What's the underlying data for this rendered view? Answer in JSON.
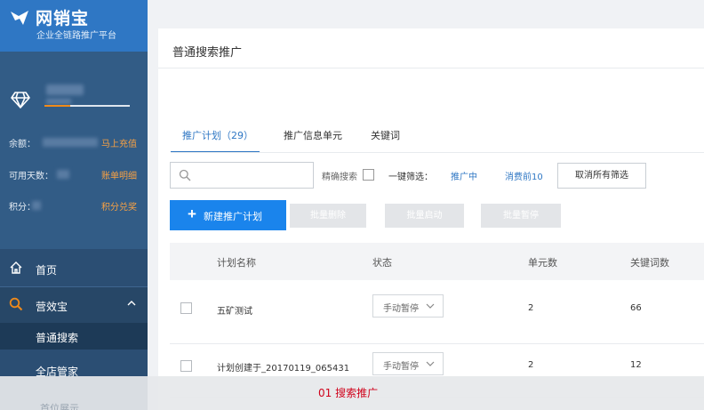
{
  "brand": {
    "name": "网销宝",
    "slogan": "企业全链路推广平台"
  },
  "account": {
    "level_progress": 0.3,
    "rows": [
      {
        "label": "余额：",
        "action": "马上充值"
      },
      {
        "label": "可用天数：",
        "action": "账单明细"
      },
      {
        "label": "积分：",
        "action": "积分兑奖"
      }
    ]
  },
  "nav": {
    "home": "首页",
    "yingxiao": "营效宝",
    "sub_putong": "普通搜索",
    "sub_quandian": "全店管家",
    "sub_next": "首位展示"
  },
  "main": {
    "page_title": "普通搜索推广",
    "tabs": [
      {
        "label": "推广计划（29）"
      },
      {
        "label": "推广信息单元"
      },
      {
        "label": "关键词"
      }
    ],
    "search_placeholder": "",
    "exact_label": "精确搜索",
    "quick_label": "一键筛选：",
    "quick_options": [
      "推广中",
      "消费前10"
    ],
    "clear_label": "取消所有筛选",
    "new_plan_label": "新建推广计划",
    "batch_delete": "批量删除",
    "batch_start": "批量启动",
    "batch_pause": "批量暂停",
    "columns": [
      "计划名称",
      "状态",
      "单元数",
      "关键词数"
    ],
    "rows": [
      {
        "name": "五矿测试",
        "status": "手动暂停",
        "units": "2",
        "keywords": "66"
      },
      {
        "name": "计划创建于_20170119_065431",
        "status": "手动暂停",
        "units": "2",
        "keywords": "12"
      }
    ]
  },
  "caption": "01 搜索推广",
  "colors": {
    "accent": "#1a84ec",
    "sidebar": "#2b4e73",
    "brand_bar": "#2f77c4",
    "warning": "#f7a144",
    "caption": "#d0021b"
  }
}
